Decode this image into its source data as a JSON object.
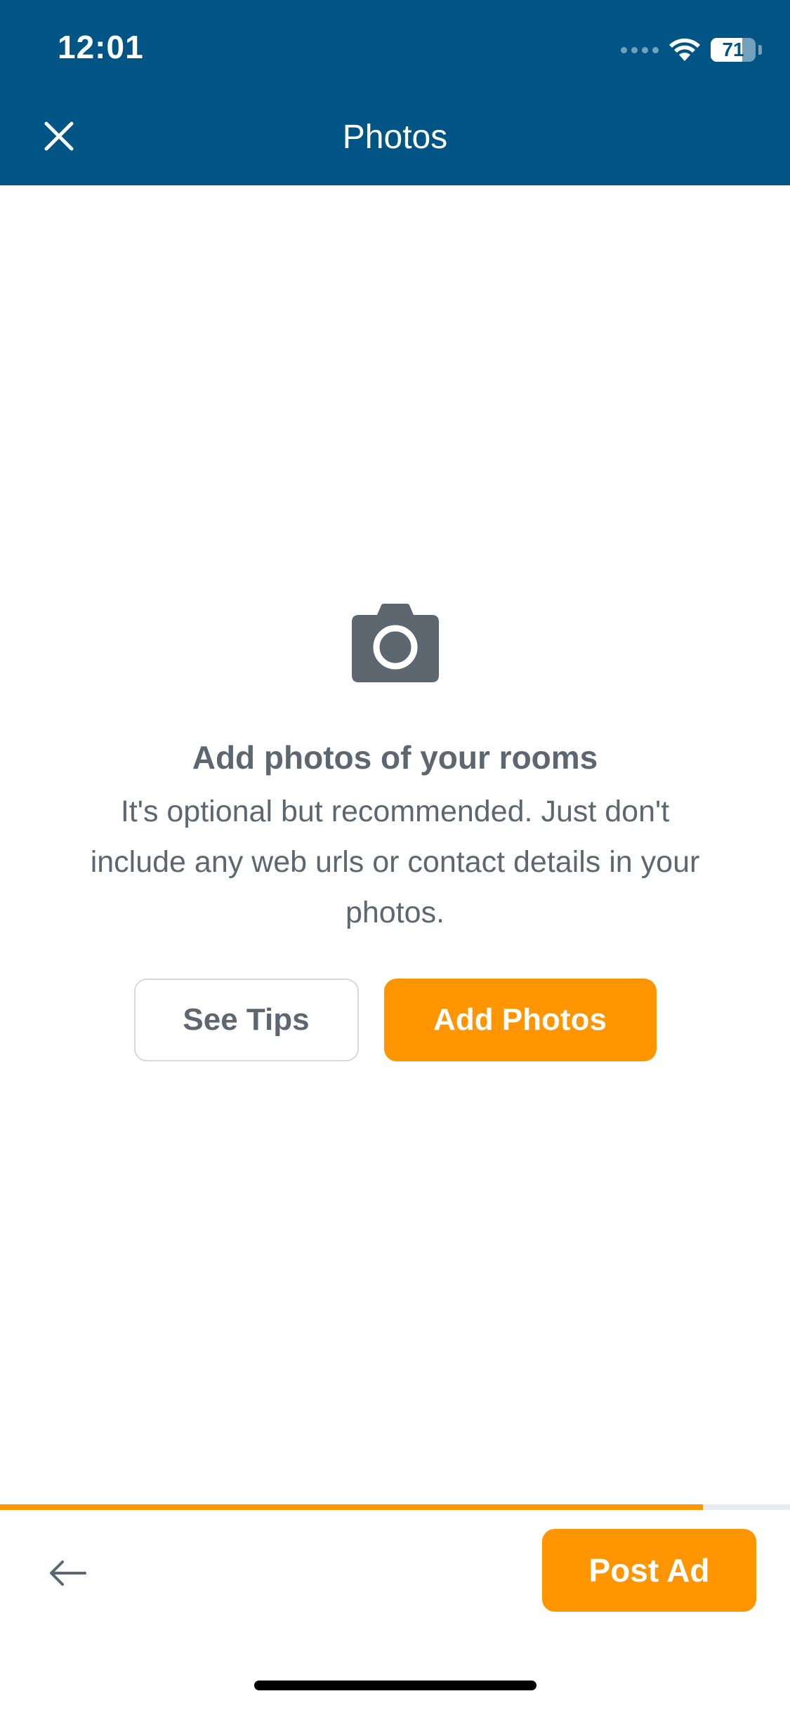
{
  "status_bar": {
    "time": "12:01",
    "battery_level": "71",
    "battery_fraction": 0.71,
    "icons": [
      "signal-dots-icon",
      "wifi-icon",
      "battery-icon"
    ]
  },
  "header": {
    "title": "Photos",
    "close_icon": "close-icon",
    "background_color": "#005585"
  },
  "empty_state": {
    "icon": "camera-icon",
    "title": "Add photos of your rooms",
    "description": "It's optional but recommended. Just don't include any web urls or contact details in your photos.",
    "see_tips_label": "See Tips",
    "add_photos_label": "Add Photos"
  },
  "footer": {
    "progress_fraction": 0.89,
    "back_icon": "arrow-left-icon",
    "post_label": "Post Ad"
  },
  "colors": {
    "accent": "#ff9500",
    "header": "#005585",
    "text_muted": "#5d6770"
  }
}
